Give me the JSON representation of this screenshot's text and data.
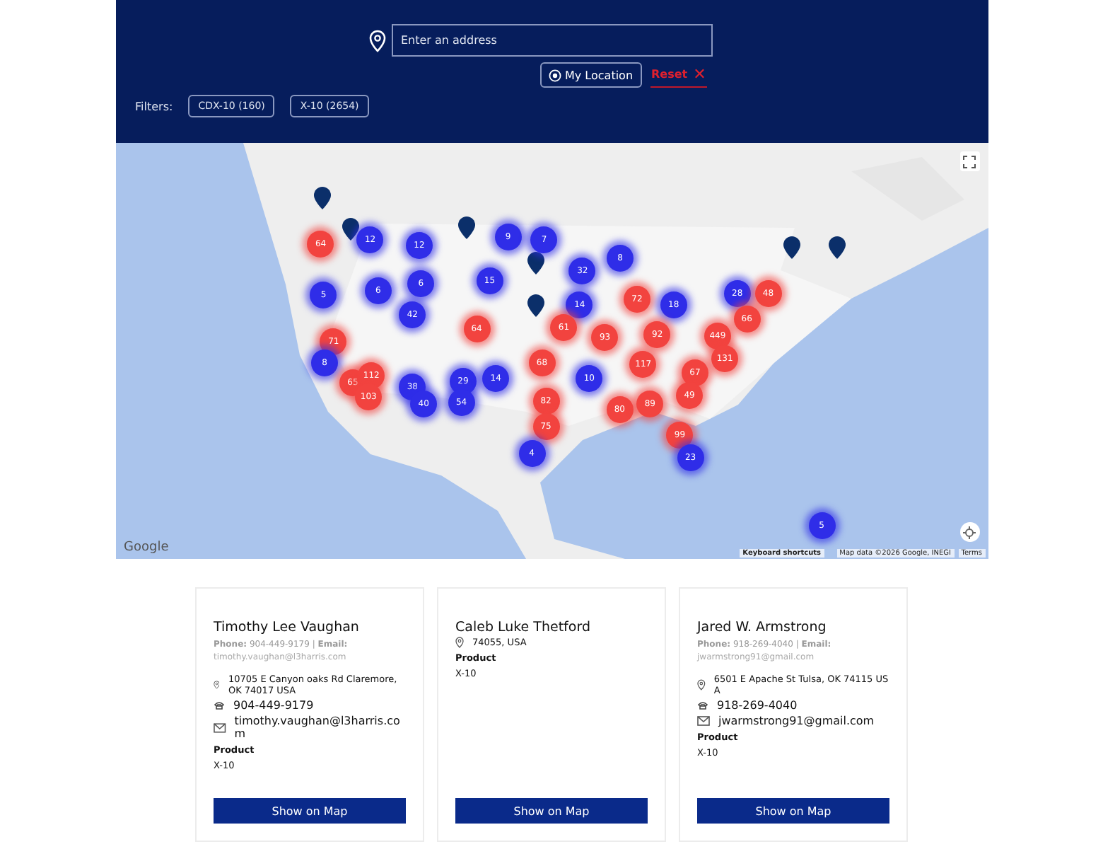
{
  "search": {
    "placeholder": "Enter an address"
  },
  "my_location": {
    "label": "My Location"
  },
  "reset": {
    "label": "Reset",
    "icon": "✕"
  },
  "filters": {
    "label": "Filters:",
    "chips": [
      {
        "label": "CDX-10 (160)"
      },
      {
        "label": "X-10 (2654)"
      }
    ]
  },
  "map": {
    "clusters": [
      {
        "count": "64",
        "color": "#f2433f"
      },
      {
        "count": "12",
        "color": "#2f2de8"
      },
      {
        "count": "12",
        "color": "#2f2de8"
      },
      {
        "count": "9",
        "color": "#2f2de8"
      },
      {
        "count": "7",
        "color": "#2f2de8"
      },
      {
        "count": "5",
        "color": "#2f2de8"
      },
      {
        "count": "6",
        "color": "#2f2de8"
      },
      {
        "count": "6",
        "color": "#2f2de8"
      },
      {
        "count": "15",
        "color": "#2f2de8"
      },
      {
        "count": "32",
        "color": "#2f2de8"
      },
      {
        "count": "8",
        "color": "#2f2de8"
      },
      {
        "count": "42",
        "color": "#2f2de8"
      },
      {
        "count": "14",
        "color": "#2f2de8"
      },
      {
        "count": "72",
        "color": "#f2433f"
      },
      {
        "count": "18",
        "color": "#2f2de8"
      },
      {
        "count": "28",
        "color": "#2f2de8"
      },
      {
        "count": "48",
        "color": "#f2433f"
      },
      {
        "count": "66",
        "color": "#f2433f"
      },
      {
        "count": "64",
        "color": "#f2433f"
      },
      {
        "count": "61",
        "color": "#f2433f"
      },
      {
        "count": "93",
        "color": "#f2433f"
      },
      {
        "count": "92",
        "color": "#f2433f"
      },
      {
        "count": "449",
        "color": "#f2433f"
      },
      {
        "count": "71",
        "color": "#f2433f"
      },
      {
        "count": "8",
        "color": "#2f2de8"
      },
      {
        "count": "68",
        "color": "#f2433f"
      },
      {
        "count": "117",
        "color": "#f2433f"
      },
      {
        "count": "131",
        "color": "#f2433f"
      },
      {
        "count": "10",
        "color": "#2f2de8"
      },
      {
        "count": "67",
        "color": "#f2433f"
      },
      {
        "count": "65",
        "color": "#f2433f"
      },
      {
        "count": "112",
        "color": "#f2433f"
      },
      {
        "count": "103",
        "color": "#f2433f"
      },
      {
        "count": "38",
        "color": "#2f2de8"
      },
      {
        "count": "29",
        "color": "#2f2de8"
      },
      {
        "count": "14",
        "color": "#2f2de8"
      },
      {
        "count": "40",
        "color": "#2f2de8"
      },
      {
        "count": "54",
        "color": "#2f2de8"
      },
      {
        "count": "82",
        "color": "#f2433f"
      },
      {
        "count": "80",
        "color": "#f2433f"
      },
      {
        "count": "89",
        "color": "#f2433f"
      },
      {
        "count": "49",
        "color": "#f2433f"
      },
      {
        "count": "75",
        "color": "#f2433f"
      },
      {
        "count": "99",
        "color": "#f2433f"
      },
      {
        "count": "23",
        "color": "#2f2de8"
      },
      {
        "count": "4",
        "color": "#2f2de8"
      },
      {
        "count": "5",
        "color": "#2f2de8"
      }
    ],
    "logo": "Google",
    "shortcuts": "Keyboard shortcuts",
    "attribution": "Map data ©2026 Google, INEGI",
    "terms": "Terms"
  },
  "cards": [
    {
      "name": "Timothy Lee Vaughan",
      "contact": "**Phone:** 904-449-9179 | **Email:**",
      "contact_email": "timothy.vaughan@l3harris.com",
      "details": [
        {
          "kind": "address",
          "text": "10705 E Canyon oaks Rd Claremore, OK 74017 USA"
        },
        {
          "kind": "phone",
          "text": "904-449-9179"
        },
        {
          "kind": "email",
          "text": "timothy.vaughan@l3harris.com"
        }
      ],
      "product_label": "Product",
      "product": "X-10",
      "button": "Show on Map"
    },
    {
      "name": "Caleb Luke Thetford",
      "details": [
        {
          "kind": "address",
          "text": "74055, USA"
        }
      ],
      "product_label": "Product",
      "product": "X-10",
      "button": "Show on Map"
    },
    {
      "name": "Jared W. Armstrong",
      "contact": "**Phone:** 918-269-4040 | **Email:**",
      "contact_email": "jwarmstrong91@gmail.com",
      "details": [
        {
          "kind": "address",
          "text": "6501 E Apache St Tulsa, OK 74115 USA"
        },
        {
          "kind": "phone",
          "text": "918-269-4040"
        },
        {
          "kind": "email",
          "text": "jwarmstrong91@gmail.com"
        }
      ],
      "product_label": "Product",
      "product": "X-10",
      "button": "Show on Map"
    }
  ]
}
